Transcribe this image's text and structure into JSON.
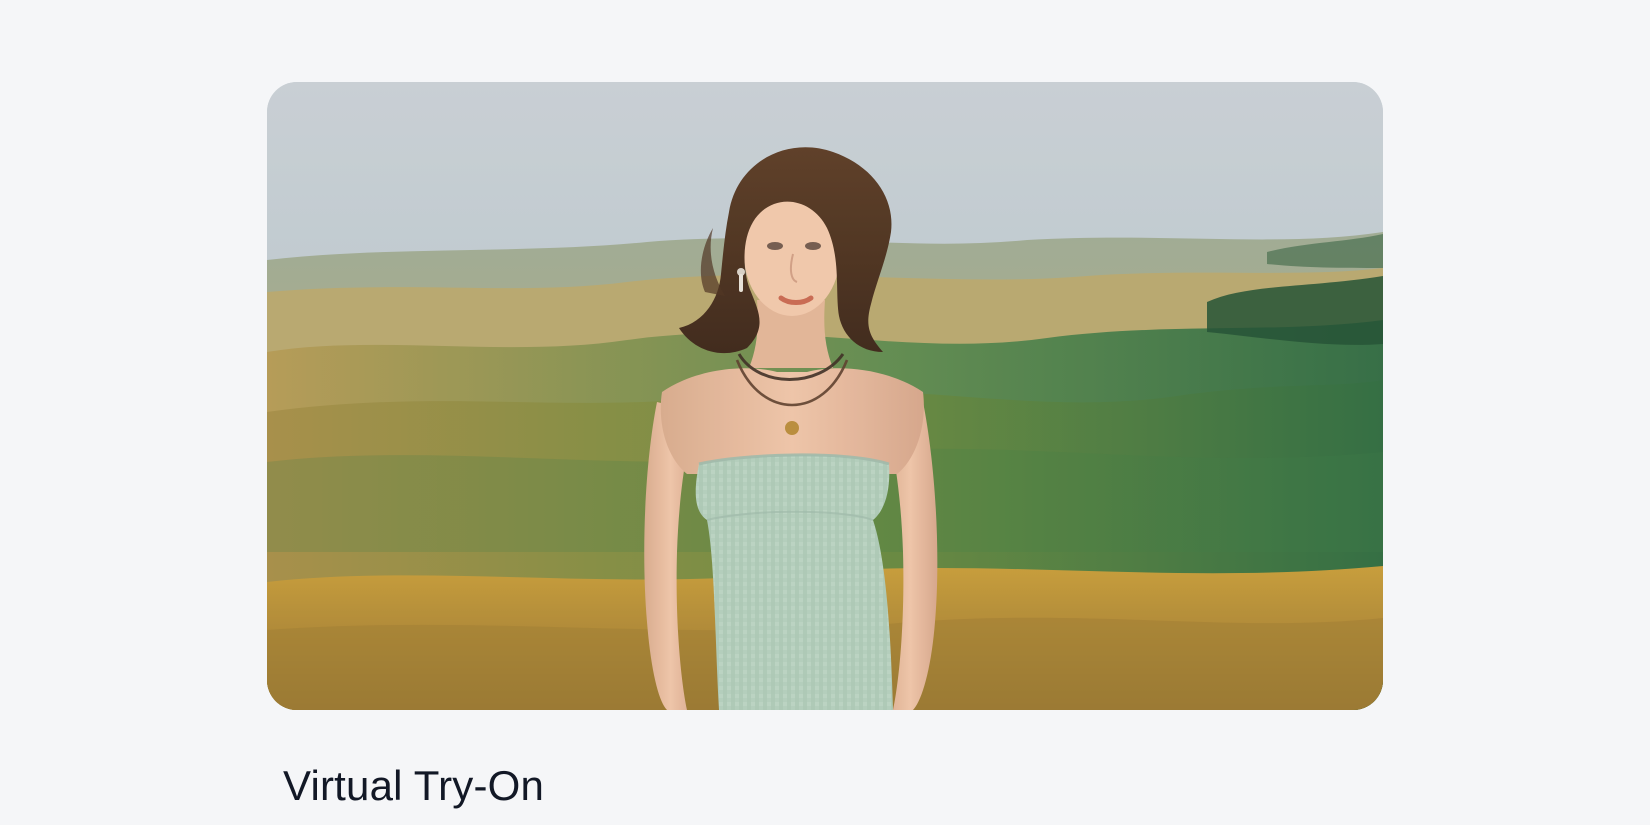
{
  "feature": {
    "title": "Virtual Try-On",
    "image": {
      "subject": "woman-in-strapless-gingham-top-on-rolling-hills",
      "icon": "photo"
    }
  },
  "colors": {
    "page_background": "#f5f6f8",
    "title_text": "#121826"
  }
}
